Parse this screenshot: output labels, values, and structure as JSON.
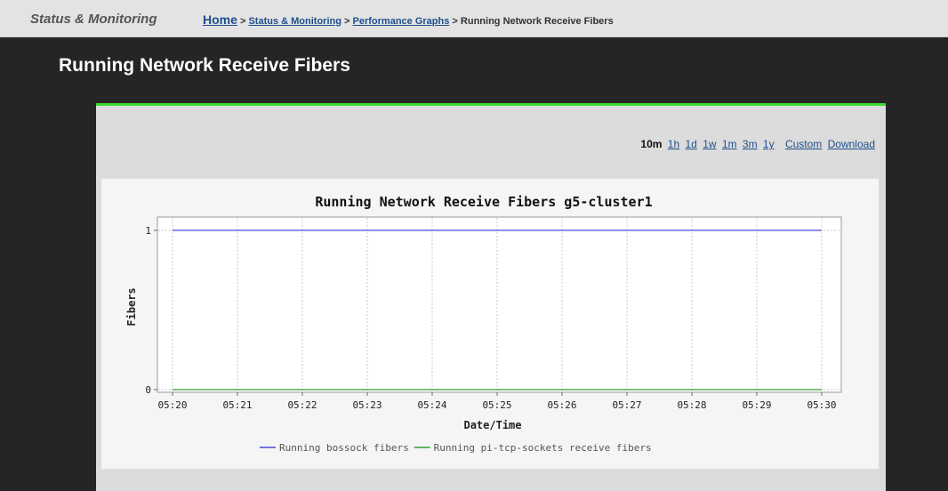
{
  "header": {
    "section": "Status & Monitoring",
    "breadcrumb": {
      "home": "Home",
      "sep": ">",
      "status": "Status & Monitoring",
      "graphs": "Performance Graphs",
      "current": "Running Network Receive Fibers"
    }
  },
  "page": {
    "title": "Running Network Receive Fibers"
  },
  "time_ranges": {
    "active": "10m",
    "links": [
      "1h",
      "1d",
      "1w",
      "1m",
      "3m",
      "1y"
    ],
    "custom": "Custom",
    "download": "Download"
  },
  "chart_data": {
    "type": "line",
    "title": "Running Network Receive Fibers g5-cluster1",
    "xlabel": "Date/Time",
    "ylabel": "Fibers",
    "x": [
      "05:20",
      "05:21",
      "05:22",
      "05:23",
      "05:24",
      "05:25",
      "05:26",
      "05:27",
      "05:28",
      "05:29",
      "05:30"
    ],
    "ylim": [
      0,
      1
    ],
    "yticks": [
      "0",
      "1"
    ],
    "grid": true,
    "legend_position": "bottom",
    "series": [
      {
        "name": "Running bossock fibers",
        "color": "#4b4bd6",
        "values": [
          1,
          1,
          1,
          1,
          1,
          1,
          1,
          1,
          1,
          1,
          1
        ]
      },
      {
        "name": "Running pi-tcp-sockets receive fibers",
        "color": "#2e9e2e",
        "values": [
          0,
          0,
          0,
          0,
          0,
          0,
          0,
          0,
          0,
          0,
          0
        ]
      }
    ]
  }
}
